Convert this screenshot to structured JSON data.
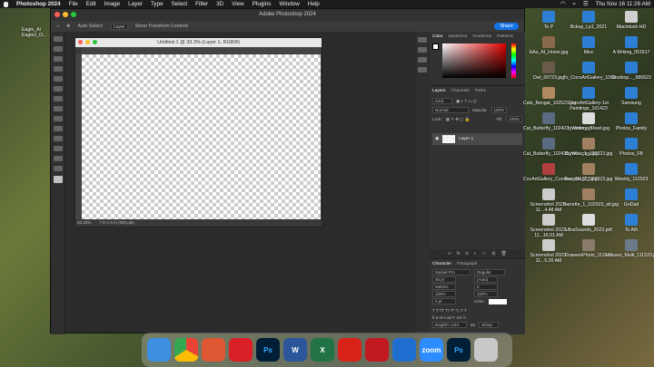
{
  "menubar": {
    "apple": "",
    "app": "Photoshop 2024",
    "items": [
      "File",
      "Edit",
      "Image",
      "Layer",
      "Type",
      "Select",
      "Filter",
      "3D",
      "View",
      "Plugins",
      "Window",
      "Help"
    ],
    "datetime": "Thu Nov 16  11:26 AM"
  },
  "ps": {
    "title": "Adobe Photoshop 2024",
    "options": {
      "auto_select": "Auto-Select:",
      "layer": "Layer",
      "transform": "Show Transform Controls",
      "share": "Share"
    },
    "doc": {
      "title": "Untitled-1 @ 33.3% (Layer 1, RGB/8)",
      "zoom": "33.33%",
      "info": "7 in x 5 in (300 ppi)"
    },
    "color_tabs": [
      "Color",
      "Swatches",
      "Gradients",
      "Patterns"
    ],
    "layers_tabs": [
      "Layers",
      "Channels",
      "Paths"
    ],
    "layers": {
      "kind": "Kind",
      "mode": "Normal",
      "opacity_label": "Opacity:",
      "opacity": "100%",
      "lock": "Lock:",
      "fill_label": "Fill:",
      "fill": "100%",
      "layer_name": "Layer 1"
    },
    "char_tabs": [
      "Character",
      "Paragraph"
    ],
    "char": {
      "font": "Myriad Pro",
      "style": "Regular",
      "size": "36 pt",
      "leading": "(Auto)",
      "kerning": "Metrics",
      "tracking": "0",
      "vscale": "100%",
      "hscale": "100%",
      "baseline": "0 pt",
      "color_label": "Color:",
      "lang": "English: USA",
      "aa_prefix": "aa",
      "aa": "Sharp"
    }
  },
  "desktop_left": [
    {
      "label": "Eagle_Al\nEagle2_O..."
    }
  ],
  "desktop": [
    {
      "label": "To P",
      "color": "#2d7fd6"
    },
    {
      "label": "Bckup_Lp1_2021",
      "color": "#2d7fd6"
    },
    {
      "label": "Macintosh HD",
      "color": "#d0d0d0"
    },
    {
      "label": "HAs_AI_Home.jpg",
      "color": "#8a6a4a"
    },
    {
      "label": "Misc",
      "color": "#2d7fd6"
    },
    {
      "label": "A Wrking_051617",
      "color": "#2d7fd6"
    },
    {
      "label": "Owl_00723.jpg",
      "color": "#6a5a4a"
    },
    {
      "label": "To_CocoArtGallery_1000",
      "color": "#2d7fd6"
    },
    {
      "label": "Desktop..._980623",
      "color": "#2d7fd6"
    },
    {
      "label": "Cats_Bengal_102523.jpg",
      "color": "#b08a60"
    },
    {
      "label": "CocoArtGallery-1st Paintings_101423",
      "color": "#2d7fd6"
    },
    {
      "label": "Samsung",
      "color": "#2d7fd6"
    },
    {
      "label": "Cat_Butterfly_102423_Wider.psd",
      "color": "#5a6a80"
    },
    {
      "label": "Inventory_Sheet.jpg",
      "color": "#dcdcdc"
    },
    {
      "label": "Photos_Family",
      "color": "#2d7fd6"
    },
    {
      "label": "Cat_Butterfly_102423_Wi...copy.jpg",
      "color": "#5a6a80"
    },
    {
      "label": "Barrette_1_102923.jpg",
      "color": "#a08060"
    },
    {
      "label": "Photos_FB",
      "color": "#2d7fd6"
    },
    {
      "label": "CocArtGallery_Cookies_111823.jpg",
      "color": "#b04040"
    },
    {
      "label": "Barrette_2_102923.jpg",
      "color": "#a08060"
    },
    {
      "label": "Weekly_112923",
      "color": "#2d7fd6"
    },
    {
      "label": "Screenshot 2023-11...4.48 AM",
      "color": "#cccccc"
    },
    {
      "label": "Barrette_1_102923_alt.jpg",
      "color": "#a08060"
    },
    {
      "label": "GoDad",
      "color": "#2d7fd6"
    },
    {
      "label": "Screenshot 2023-11...16.01 AM",
      "color": "#cccccc"
    },
    {
      "label": "UltraSounds_2023.pdf",
      "color": "#dddddd"
    },
    {
      "label": "To Ath",
      "color": "#2d7fd6"
    },
    {
      "label": "Screenshot 2023-11...5.20 AM",
      "color": "#cccccc"
    },
    {
      "label": "DrawersPhoto_111623",
      "color": "#8a7a6a"
    },
    {
      "label": "Houses_Multi_111523.jpg",
      "color": "#6a7a8a"
    }
  ],
  "dock": [
    {
      "name": "finder-icon",
      "color": "#3d8fe0",
      "text": ""
    },
    {
      "name": "chrome-icon",
      "color": "#e8e8e8",
      "text": ""
    },
    {
      "name": "duckduckgo-icon",
      "color": "#de5833",
      "text": ""
    },
    {
      "name": "creative-cloud-icon",
      "color": "#da1f26",
      "text": ""
    },
    {
      "name": "photoshop-icon",
      "color": "#001e36",
      "text": "Ps"
    },
    {
      "name": "word-icon",
      "color": "#2b579a",
      "text": "W"
    },
    {
      "name": "excel-icon",
      "color": "#217346",
      "text": "X"
    },
    {
      "name": "acrobat-icon",
      "color": "#d9221a",
      "text": ""
    },
    {
      "name": "acrobat-reader-icon",
      "color": "#c1191f",
      "text": ""
    },
    {
      "name": "scanner-icon",
      "color": "#1f6fd1",
      "text": ""
    },
    {
      "name": "zoom-icon",
      "color": "#2d8cff",
      "text": "zoom"
    },
    {
      "name": "photoshop-dock2-icon",
      "color": "#001e36",
      "text": "Ps"
    },
    {
      "name": "trash-icon",
      "color": "#c8c8c8",
      "text": ""
    }
  ]
}
